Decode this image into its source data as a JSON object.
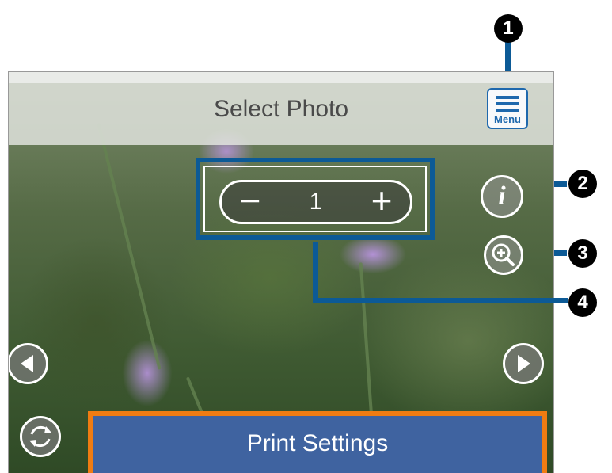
{
  "header": {
    "title": "Select Photo"
  },
  "menu_button": {
    "label": "Menu"
  },
  "stepper": {
    "minus": "−",
    "value": "1",
    "plus": "+"
  },
  "info_button": {
    "label": "i"
  },
  "print_button": {
    "label": "Print Settings"
  },
  "callouts": [
    "1",
    "2",
    "3",
    "4"
  ],
  "colors": {
    "accent_blue": "#0c5a96",
    "print_button": "#3f63a0",
    "highlight_orange": "#f07c12"
  }
}
